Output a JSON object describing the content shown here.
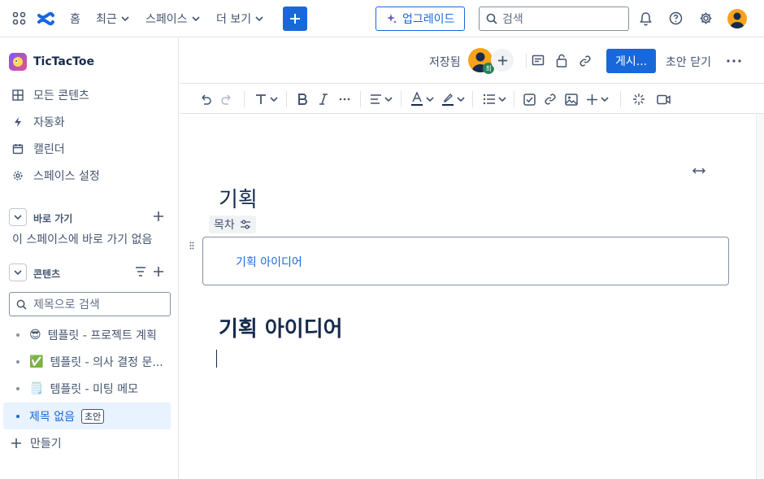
{
  "topnav": {
    "home": "홈",
    "recent": "최근",
    "spaces": "스페이스",
    "more": "더 보기",
    "upgrade": "업그레이드",
    "search_placeholder": "검색"
  },
  "sidebar": {
    "space_name": "TicTacToe",
    "nav_items": [
      {
        "label": "모든 콘텐츠",
        "icon": "grid-icon"
      },
      {
        "label": "자동화",
        "icon": "lightning-icon"
      },
      {
        "label": "캘린더",
        "icon": "calendar-icon"
      },
      {
        "label": "스페이스 설정",
        "icon": "gear-icon"
      }
    ],
    "shortcuts": {
      "title": "바로 가기",
      "empty_text": "이 스페이스에 바로 가기 없음"
    },
    "content": {
      "title": "콘텐츠",
      "search_placeholder": "제목으로 검색",
      "items": [
        {
          "emoji": "😎",
          "label": "템플릿 - 프로젝트 계획"
        },
        {
          "emoji": "✅",
          "label": "템플릿 - 의사 결정 문..."
        },
        {
          "emoji": "🗒️",
          "label": "템플릿 - 미팅 메모"
        },
        {
          "emoji": "",
          "label": "제목 없음",
          "badge": "초안"
        }
      ]
    },
    "create": "만들기"
  },
  "editor": {
    "saved": "저장됨",
    "collab_initial": "최",
    "publish": "게시...",
    "close_draft": "초안 닫기",
    "page_title": "기획",
    "toc_label": "목차",
    "toc_entries": [
      "기획 아이디어"
    ],
    "heading": "기획 아이디어"
  },
  "colors": {
    "accent": "#1868db",
    "avatar": "#f8a31a",
    "selected_bg": "#e9f2ff"
  }
}
